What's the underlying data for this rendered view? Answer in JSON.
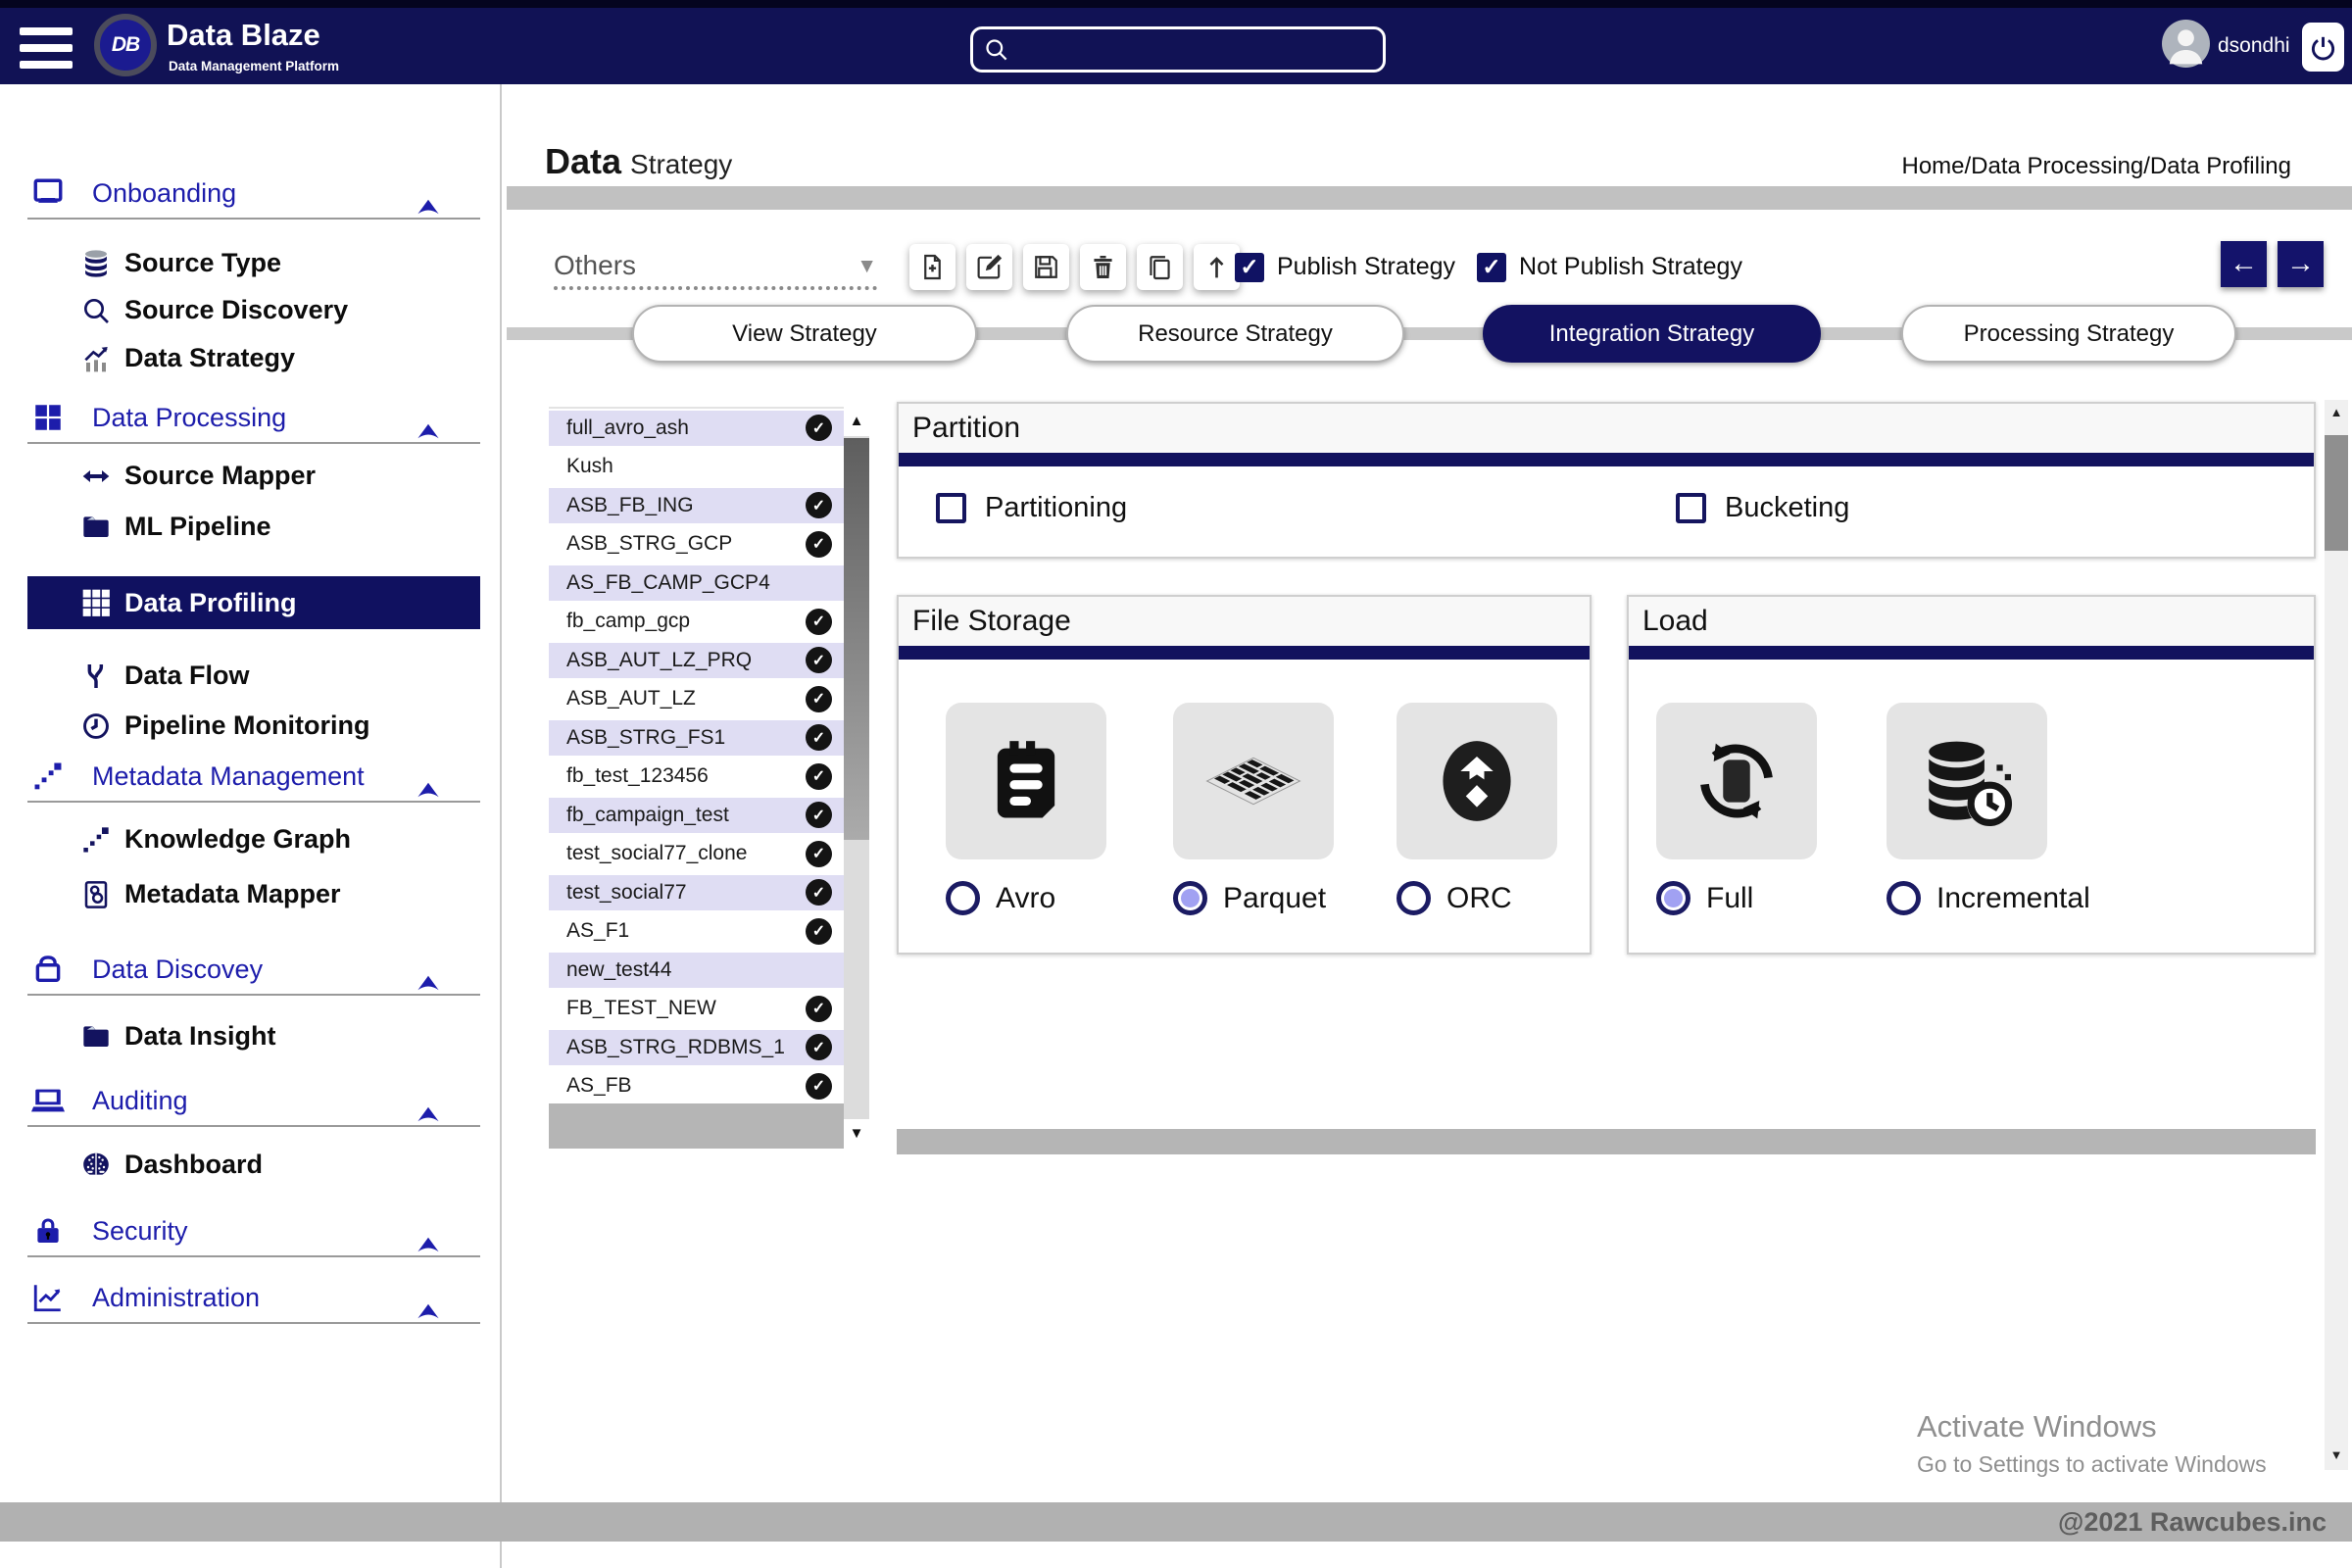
{
  "theme": {
    "navy": "#12125a",
    "accent_blue": "#1d1dab",
    "lavender_row": "#dfddf3",
    "radio_selected_fill": "#a1a1f2",
    "gray_bar": "#c1c1c1"
  },
  "header": {
    "app_name": "Data Blaze",
    "app_subtitle": "Data Management Platform",
    "logo_text": "DB",
    "username": "dsondhi"
  },
  "page": {
    "title_primary": "Data",
    "title_secondary": "Strategy",
    "breadcrumb": "Home/Data Processing/Data Profiling",
    "activate_line1": "Activate Windows",
    "activate_line2": "Go to Settings to activate Windows",
    "footer_text": "@2021 Rawcubes.inc"
  },
  "sidebar": {
    "items": [
      {
        "type": "section",
        "label": "Onboanding",
        "icon": "monitor-icon",
        "chevron": true
      },
      {
        "type": "item",
        "label": "Source Type",
        "icon": "database-icon"
      },
      {
        "type": "item",
        "label": "Source Discovery",
        "icon": "search-icon"
      },
      {
        "type": "item",
        "label": "Data Strategy",
        "icon": "chart-growth-icon"
      },
      {
        "type": "section",
        "label": "Data Processing",
        "icon": "grid4-icon",
        "chevron": true
      },
      {
        "type": "item",
        "label": "Source Mapper",
        "icon": "arrows-horizontal-icon"
      },
      {
        "type": "item",
        "label": "ML Pipeline",
        "icon": "folder-icon"
      },
      {
        "type": "item",
        "label": "Data Profiling",
        "icon": "grid9-icon",
        "active": true
      },
      {
        "type": "item",
        "label": "Data Flow",
        "icon": "flow-branch-icon"
      },
      {
        "type": "item",
        "label": "Pipeline Monitoring",
        "icon": "clock-icon"
      },
      {
        "type": "section",
        "label": "Metadata Management",
        "icon": "scatter-diagonal-icon",
        "chevron": true
      },
      {
        "type": "item",
        "label": "Knowledge Graph",
        "icon": "scatter-diagonal-icon"
      },
      {
        "type": "item",
        "label": "Metadata Mapper",
        "icon": "metadata-doc-icon"
      },
      {
        "type": "section",
        "label": "Data Discovey",
        "icon": "lock-outline-icon",
        "chevron": true
      },
      {
        "type": "item",
        "label": "Data Insight",
        "icon": "folder-icon"
      },
      {
        "type": "section",
        "label": "Auditing",
        "icon": "laptop-icon",
        "chevron": true
      },
      {
        "type": "item",
        "label": "Dashboard",
        "icon": "brain-icon"
      },
      {
        "type": "section",
        "label": "Security",
        "icon": "lock-filled-icon",
        "chevron": true
      },
      {
        "type": "section",
        "label": "Administration",
        "icon": "chart-line-icon",
        "chevron": true
      }
    ]
  },
  "toolbar": {
    "dropdown_label": "Others",
    "icons": [
      "new-file-icon",
      "edit-icon",
      "save-icon",
      "delete-icon",
      "copy-icon",
      "upload-icon"
    ],
    "checkboxes": [
      {
        "label": "Publish Strategy",
        "checked": true
      },
      {
        "label": "Not Publish Strategy",
        "checked": true
      }
    ]
  },
  "steps": [
    {
      "label": "View Strategy",
      "active": false
    },
    {
      "label": "Resource Strategy",
      "active": false
    },
    {
      "label": "Integration Strategy",
      "active": true
    },
    {
      "label": "Processing Strategy",
      "active": false
    }
  ],
  "strategy_list": {
    "items": [
      {
        "name": "full_avro_ash",
        "checked": true
      },
      {
        "name": "Kush",
        "checked": false
      },
      {
        "name": "ASB_FB_ING",
        "checked": true
      },
      {
        "name": "ASB_STRG_GCP",
        "checked": true
      },
      {
        "name": "AS_FB_CAMP_GCP4",
        "checked": false
      },
      {
        "name": "fb_camp_gcp",
        "checked": true
      },
      {
        "name": "ASB_AUT_LZ_PRQ",
        "checked": true
      },
      {
        "name": "ASB_AUT_LZ",
        "checked": true
      },
      {
        "name": "ASB_STRG_FS1",
        "checked": true
      },
      {
        "name": "fb_test_123456",
        "checked": true
      },
      {
        "name": "fb_campaign_test",
        "checked": true
      },
      {
        "name": "test_social77_clone",
        "checked": true
      },
      {
        "name": "test_social77",
        "checked": true
      },
      {
        "name": "AS_F1",
        "checked": true
      },
      {
        "name": "new_test44",
        "checked": false
      },
      {
        "name": "FB_TEST_NEW",
        "checked": true
      },
      {
        "name": "ASB_STRG_RDBMS_1",
        "checked": true
      },
      {
        "name": "AS_FB",
        "checked": true
      }
    ]
  },
  "partition": {
    "title": "Partition",
    "options": [
      {
        "label": "Partitioning",
        "checked": false
      },
      {
        "label": "Bucketing",
        "checked": false
      }
    ]
  },
  "file_storage": {
    "title": "File Storage",
    "options": [
      {
        "label": "Avro",
        "icon": "avro-icon",
        "selected": false
      },
      {
        "label": "Parquet",
        "icon": "parquet-icon",
        "selected": true
      },
      {
        "label": "ORC",
        "icon": "orc-icon",
        "selected": false
      }
    ]
  },
  "load": {
    "title": "Load",
    "options": [
      {
        "label": "Full",
        "icon": "full-load-icon",
        "selected": true
      },
      {
        "label": "Incremental",
        "icon": "incremental-load-icon",
        "selected": false
      }
    ]
  }
}
